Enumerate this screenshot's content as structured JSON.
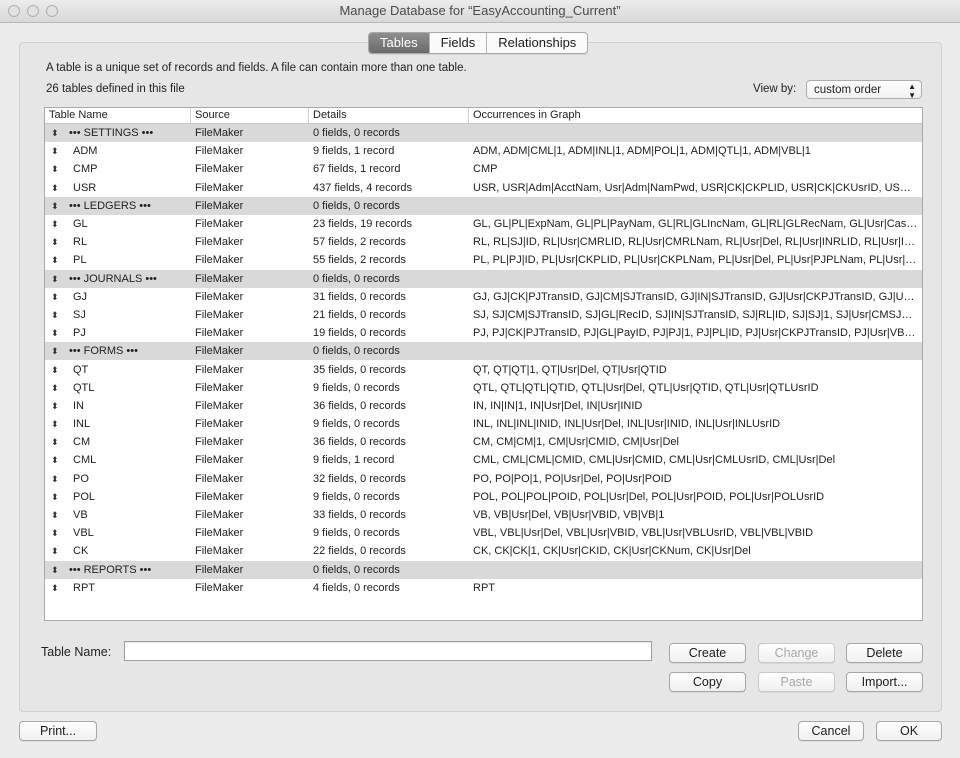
{
  "window": {
    "title": "Manage Database for “EasyAccounting_Current”"
  },
  "tabs": [
    {
      "label": "Tables",
      "active": true
    },
    {
      "label": "Fields",
      "active": false
    },
    {
      "label": "Relationships",
      "active": false
    }
  ],
  "description": "A table is a unique set of records and fields. A file can contain more than one table.",
  "table_count": "26 tables defined in this file",
  "view_by": {
    "label": "View by:",
    "selected": "custom order"
  },
  "columns": [
    "Table Name",
    "Source",
    "Details",
    "Occurrences in Graph"
  ],
  "rows": [
    {
      "name": "••• SETTINGS •••",
      "source": "FileMaker",
      "details": "0 fields, 0 records",
      "occurrences": "",
      "section": true
    },
    {
      "name": "ADM",
      "source": "FileMaker",
      "details": "9 fields, 1 record",
      "occurrences": "ADM, ADM|CML|1, ADM|INL|1, ADM|POL|1, ADM|QTL|1, ADM|VBL|1"
    },
    {
      "name": "CMP",
      "source": "FileMaker",
      "details": "67 fields, 1 record",
      "occurrences": "CMP"
    },
    {
      "name": "USR",
      "source": "FileMaker",
      "details": "437 fields, 4 records",
      "occurrences": "USR, USR|Adm|AcctNam, Usr|Adm|NamPwd, USR|CK|CKPLID, USR|CK|CKUsrID, USR|C..."
    },
    {
      "name": "••• LEDGERS •••",
      "source": "FileMaker",
      "details": "0 fields, 0 records",
      "occurrences": "",
      "section": true
    },
    {
      "name": "GL",
      "source": "FileMaker",
      "details": "23 fields, 19 records",
      "occurrences": "GL, GL|PL|ExpNam, GL|PL|PayNam, GL|RL|GLIncNam, GL|RL|GLRecNam, GL|Usr|Cash..."
    },
    {
      "name": "RL",
      "source": "FileMaker",
      "details": "57 fields, 2 records",
      "occurrences": "RL, RL|SJ|ID, RL|Usr|CMRLID, RL|Usr|CMRLNam, RL|Usr|Del, RL|Usr|INRLID, RL|Usr|IN..."
    },
    {
      "name": "PL",
      "source": "FileMaker",
      "details": "55 fields, 2 records",
      "occurrences": "PL, PL|PJ|ID, PL|Usr|CKPLID, PL|Usr|CKPLNam, PL|Usr|Del, PL|Usr|PJPLNam, PL|Usr|PJU..."
    },
    {
      "name": "••• JOURNALS •••",
      "source": "FileMaker",
      "details": "0 fields, 0 records",
      "occurrences": "",
      "section": true
    },
    {
      "name": "GJ",
      "source": "FileMaker",
      "details": "31 fields, 0 records",
      "occurrences": "GJ, GJ|CK|PJTransID, GJ|CM|SJTransID, GJ|IN|SJTransID, GJ|Usr|CKPJTransID, GJ|Usr|C..."
    },
    {
      "name": "SJ",
      "source": "FileMaker",
      "details": "21 fields, 0 records",
      "occurrences": "SJ, SJ|CM|SJTransID, SJ|GL|RecID, SJ|IN|SJTransID, SJ|RL|ID, SJ|SJ|1, SJ|Usr|CMSJTransI..."
    },
    {
      "name": "PJ",
      "source": "FileMaker",
      "details": "19 fields, 0 records",
      "occurrences": "PJ, PJ|CK|PJTransID, PJ|GL|PayID, PJ|PJ|1, PJ|PL|ID, PJ|Usr|CKPJTransID, PJ|Usr|VBPJTran..."
    },
    {
      "name": "••• FORMS •••",
      "source": "FileMaker",
      "details": "0 fields, 0 records",
      "occurrences": "",
      "section": true
    },
    {
      "name": "QT",
      "source": "FileMaker",
      "details": "35 fields, 0 records",
      "occurrences": "QT, QT|QT|1, QT|Usr|Del, QT|Usr|QTID"
    },
    {
      "name": "QTL",
      "source": "FileMaker",
      "details": "9 fields, 0 records",
      "occurrences": "QTL, QTL|QTL|QTID, QTL|Usr|Del, QTL|Usr|QTID, QTL|Usr|QTLUsrID"
    },
    {
      "name": "IN",
      "source": "FileMaker",
      "details": "36 fields, 0 records",
      "occurrences": "IN, IN|IN|1, IN|Usr|Del, IN|Usr|INID"
    },
    {
      "name": "INL",
      "source": "FileMaker",
      "details": "9 fields, 0 records",
      "occurrences": "INL, INL|INL|INID, INL|Usr|Del, INL|Usr|INID, INL|Usr|INLUsrID"
    },
    {
      "name": "CM",
      "source": "FileMaker",
      "details": "36 fields, 0 records",
      "occurrences": "CM, CM|CM|1, CM|Usr|CMID, CM|Usr|Del"
    },
    {
      "name": "CML",
      "source": "FileMaker",
      "details": "9 fields, 1 record",
      "occurrences": "CML, CML|CML|CMID, CML|Usr|CMID, CML|Usr|CMLUsrID, CML|Usr|Del"
    },
    {
      "name": "PO",
      "source": "FileMaker",
      "details": "32 fields, 0 records",
      "occurrences": "PO, PO|PO|1, PO|Usr|Del, PO|Usr|POID"
    },
    {
      "name": "POL",
      "source": "FileMaker",
      "details": "9 fields, 0 records",
      "occurrences": "POL, POL|POL|POID, POL|Usr|Del, POL|Usr|POID, POL|Usr|POLUsrID"
    },
    {
      "name": "VB",
      "source": "FileMaker",
      "details": "33 fields, 0 records",
      "occurrences": "VB, VB|Usr|Del, VB|Usr|VBID, VB|VB|1"
    },
    {
      "name": "VBL",
      "source": "FileMaker",
      "details": "9 fields, 0 records",
      "occurrences": "VBL, VBL|Usr|Del, VBL|Usr|VBID, VBL|Usr|VBLUsrID, VBL|VBL|VBID"
    },
    {
      "name": "CK",
      "source": "FileMaker",
      "details": "22 fields, 0 records",
      "occurrences": "CK, CK|CK|1, CK|Usr|CKID, CK|Usr|CKNum, CK|Usr|Del"
    },
    {
      "name": "••• REPORTS •••",
      "source": "FileMaker",
      "details": "0 fields, 0 records",
      "occurrences": "",
      "section": true
    },
    {
      "name": "RPT",
      "source": "FileMaker",
      "details": "4 fields, 0 records",
      "occurrences": "RPT"
    }
  ],
  "table_name_field": {
    "label": "Table Name:",
    "value": ""
  },
  "buttons": {
    "create": "Create",
    "change": "Change",
    "delete": "Delete",
    "copy": "Copy",
    "paste": "Paste",
    "import": "Import...",
    "print": "Print...",
    "cancel": "Cancel",
    "ok": "OK"
  }
}
